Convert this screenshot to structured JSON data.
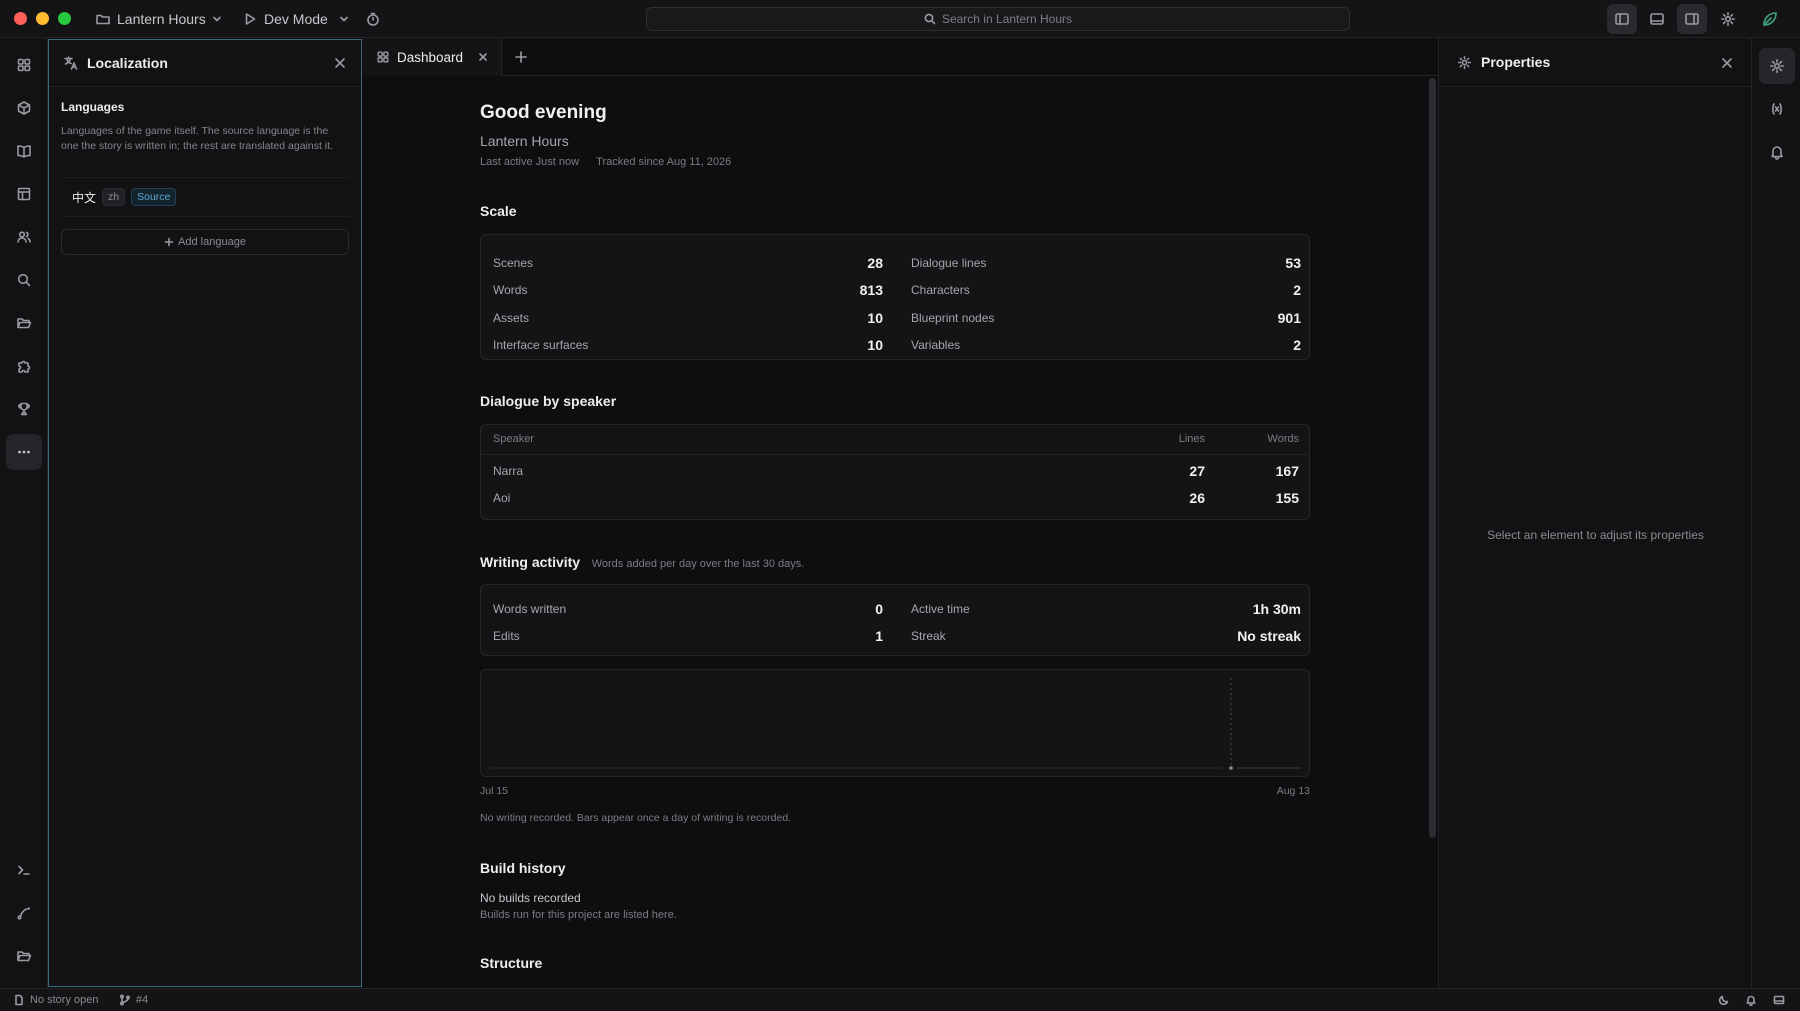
{
  "titlebar": {
    "project_name": "Lantern Hours",
    "mode_label": "Dev Mode",
    "search_placeholder": "Search in Lantern Hours"
  },
  "localization": {
    "title": "Localization",
    "section_title": "Languages",
    "section_desc": "Languages of the game itself. The source language is the one the story is written in; the rest are translated against it.",
    "language": {
      "name": "中文",
      "code": "zh",
      "badge": "Source"
    },
    "add_label": "Add language"
  },
  "tabs": [
    {
      "label": "Dashboard"
    }
  ],
  "dashboard": {
    "greeting": "Good evening",
    "project": "Lantern Hours",
    "last_active_label": "Last active",
    "last_active_value": "Just now",
    "tracked_since": "Tracked since Aug 11, 2026",
    "scale": {
      "title": "Scale",
      "left": [
        {
          "label": "Scenes",
          "value": "28"
        },
        {
          "label": "Words",
          "value": "813"
        },
        {
          "label": "Assets",
          "value": "10"
        },
        {
          "label": "Interface surfaces",
          "value": "10"
        }
      ],
      "right": [
        {
          "label": "Dialogue lines",
          "value": "53"
        },
        {
          "label": "Characters",
          "value": "2"
        },
        {
          "label": "Blueprint nodes",
          "value": "901"
        },
        {
          "label": "Variables",
          "value": "2"
        }
      ]
    },
    "speakers": {
      "title": "Dialogue by speaker",
      "columns": [
        "Speaker",
        "Lines",
        "Words"
      ],
      "rows": [
        {
          "name": "Narra",
          "lines": "27",
          "words": "167"
        },
        {
          "name": "Aoi",
          "lines": "26",
          "words": "155"
        }
      ]
    },
    "activity": {
      "title": "Writing activity",
      "subtitle": "Words added per day over the last 30 days.",
      "left": [
        {
          "label": "Words written",
          "value": "0"
        },
        {
          "label": "Edits",
          "value": "1"
        }
      ],
      "right": [
        {
          "label": "Active time",
          "value": "1h 30m"
        },
        {
          "label": "Streak",
          "value": "No streak"
        }
      ],
      "chart_start": "Jul 15",
      "chart_end": "Aug 13",
      "empty_note": "No writing recorded. Bars appear once a day of writing is recorded."
    },
    "builds": {
      "title": "Build history",
      "empty_title": "No builds recorded",
      "empty_desc": "Builds run for this project are listed here."
    },
    "structure_title": "Structure"
  },
  "chart_data": {
    "type": "bar",
    "x": [
      "Jul 15",
      "Aug 13"
    ],
    "values": [],
    "title": "",
    "xlabel": "",
    "ylabel": ""
  },
  "properties": {
    "title": "Properties",
    "empty": "Select an element to adjust its properties"
  },
  "status": {
    "story": "No story open",
    "branch": "#4"
  },
  "colors": {
    "accent": "#3a6a80",
    "source_badge": "#5aa9d6",
    "brand_leaf": "#3fa37a"
  }
}
